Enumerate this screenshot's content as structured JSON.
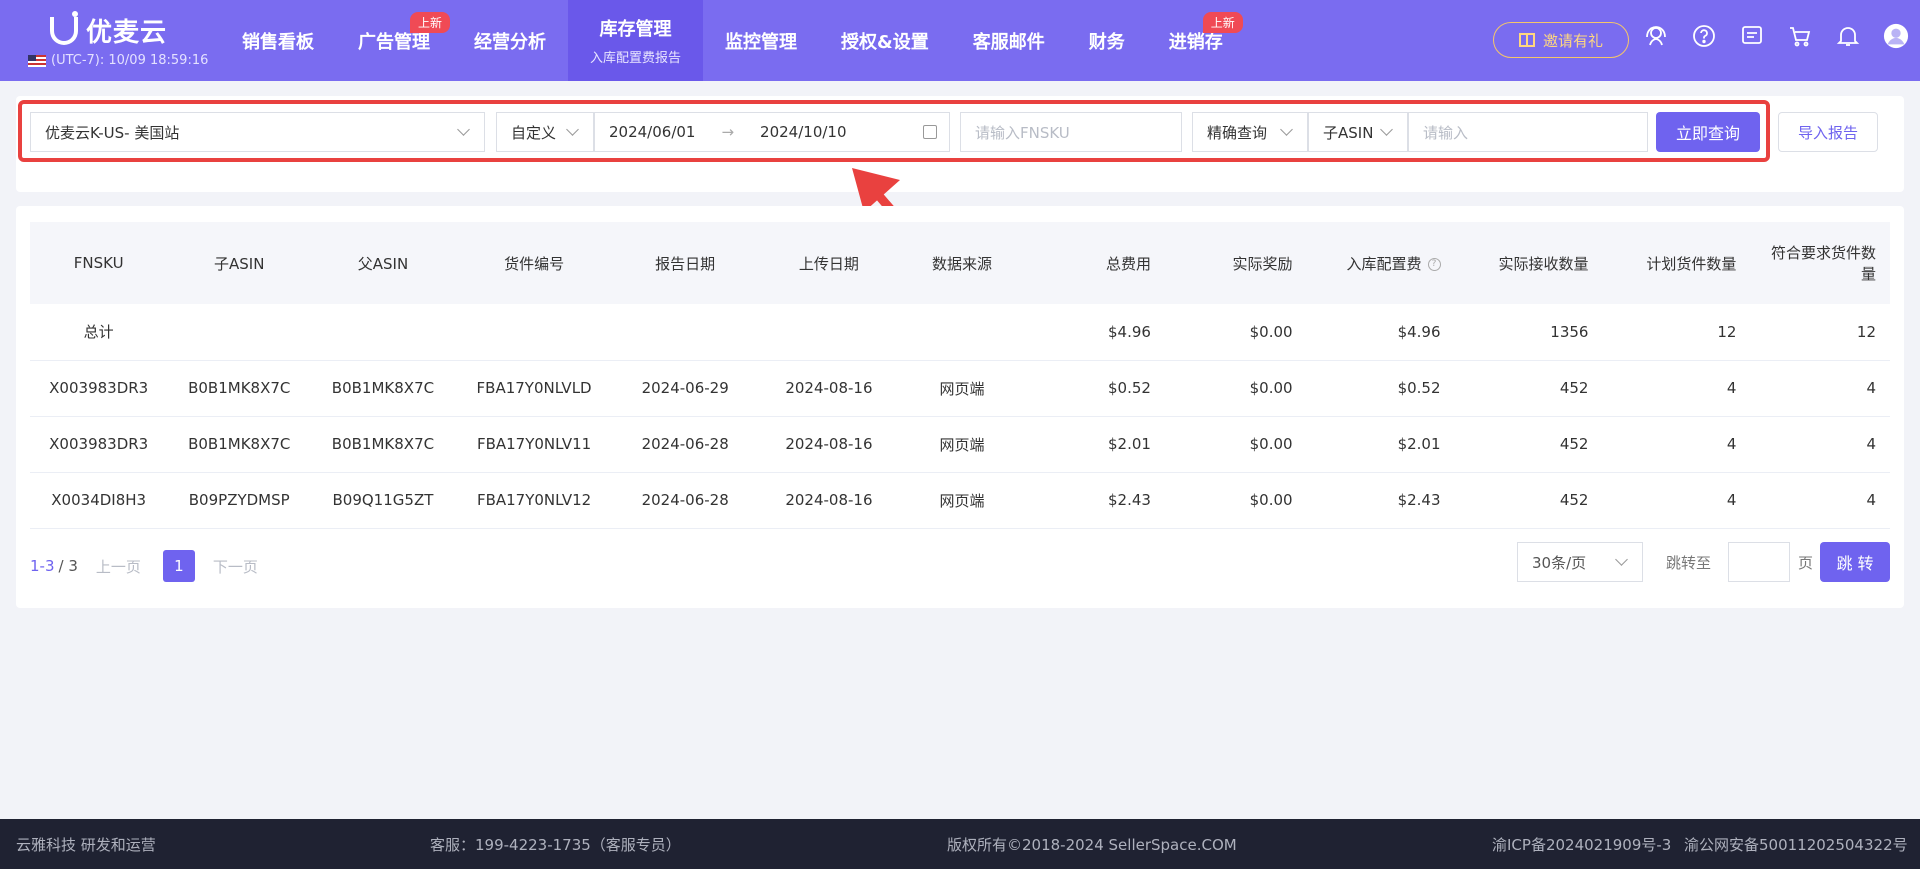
{
  "header": {
    "logo_text": "优麦云",
    "timezone": "(UTC-7): 10/09 18:59:16",
    "nav": [
      {
        "label": "销售看板",
        "sub": "",
        "badge": "",
        "active": false
      },
      {
        "label": "广告管理",
        "sub": "",
        "badge": "上新",
        "active": false
      },
      {
        "label": "经营分析",
        "sub": "",
        "badge": "",
        "active": false
      },
      {
        "label": "库存管理",
        "sub": "入库配置费报告",
        "badge": "",
        "active": true
      },
      {
        "label": "监控管理",
        "sub": "",
        "badge": "",
        "active": false
      },
      {
        "label": "授权&设置",
        "sub": "",
        "badge": "",
        "active": false
      },
      {
        "label": "客服邮件",
        "sub": "",
        "badge": "",
        "active": false
      },
      {
        "label": "财务",
        "sub": "",
        "badge": "",
        "active": false
      },
      {
        "label": "进销存",
        "sub": "",
        "badge": "上新",
        "active": false
      }
    ],
    "invite_label": "邀请有礼",
    "icons": [
      "service-icon",
      "help-icon",
      "message-icon",
      "cart-icon",
      "bell-icon",
      "user-avatar-icon"
    ]
  },
  "filters": {
    "store": "优麦云K-US- 美国站",
    "date_mode": "自定义",
    "date_start": "2024/06/01",
    "date_sep": "→",
    "date_end": "2024/10/10",
    "fnsku_placeholder": "请输入FNSKU",
    "match_mode": "精确查询",
    "search_field": "子ASIN",
    "search_placeholder": "请输入",
    "query_button": "立即查询",
    "import_button": "导入报告"
  },
  "table": {
    "columns": [
      "FNSKU",
      "子ASIN",
      "父ASIN",
      "货件编号",
      "报告日期",
      "上传日期",
      "数据来源",
      "总费用",
      "实际奖励",
      "入库配置费",
      "实际接收数量",
      "计划货件数量",
      "符合要求货件数量"
    ],
    "total_row": {
      "label": "总计",
      "total_fee": "$4.96",
      "reward": "$0.00",
      "inbound_fee": "$4.96",
      "received": "1356",
      "planned": "12",
      "qualified": "12"
    },
    "rows": [
      {
        "fnsku": "X003983DR3",
        "child_asin": "B0B1MK8X7C",
        "parent_asin": "B0B1MK8X7C",
        "shipment": "FBA17Y0NLVLD",
        "report_date": "2024-06-29",
        "upload_date": "2024-08-16",
        "source": "网页端",
        "total_fee": "$0.52",
        "reward": "$0.00",
        "inbound_fee": "$0.52",
        "received": "452",
        "planned": "4",
        "qualified": "4"
      },
      {
        "fnsku": "X003983DR3",
        "child_asin": "B0B1MK8X7C",
        "parent_asin": "B0B1MK8X7C",
        "shipment": "FBA17Y0NLV11",
        "report_date": "2024-06-28",
        "upload_date": "2024-08-16",
        "source": "网页端",
        "total_fee": "$2.01",
        "reward": "$0.00",
        "inbound_fee": "$2.01",
        "received": "452",
        "planned": "4",
        "qualified": "4"
      },
      {
        "fnsku": "X0034DI8H3",
        "child_asin": "B09PZYDMSP",
        "parent_asin": "B09Q11G5ZT",
        "shipment": "FBA17Y0NLV12",
        "report_date": "2024-06-28",
        "upload_date": "2024-08-16",
        "source": "网页端",
        "total_fee": "$2.43",
        "reward": "$0.00",
        "inbound_fee": "$2.43",
        "received": "452",
        "planned": "4",
        "qualified": "4"
      }
    ]
  },
  "pagination": {
    "range": "1-3",
    "total": "/ 3",
    "prev": "上一页",
    "current": "1",
    "next": "下一页",
    "page_size": "30条/页",
    "jump_label": "跳转至",
    "jump_unit": "页",
    "jump_button": "跳 转"
  },
  "footer": {
    "company": "云雅科技 研发和运营",
    "service": "客服：199-4223-1735（客服专员）",
    "copyright": "版权所有©2018-2024 SellerSpace.COM",
    "icp": "渝ICP备2024021909号-3",
    "police": "渝公网安备50011202504322号"
  },
  "colors": {
    "brand": "#7a6cf0",
    "accent": "#6f63ef",
    "highlight": "#e9413f"
  }
}
